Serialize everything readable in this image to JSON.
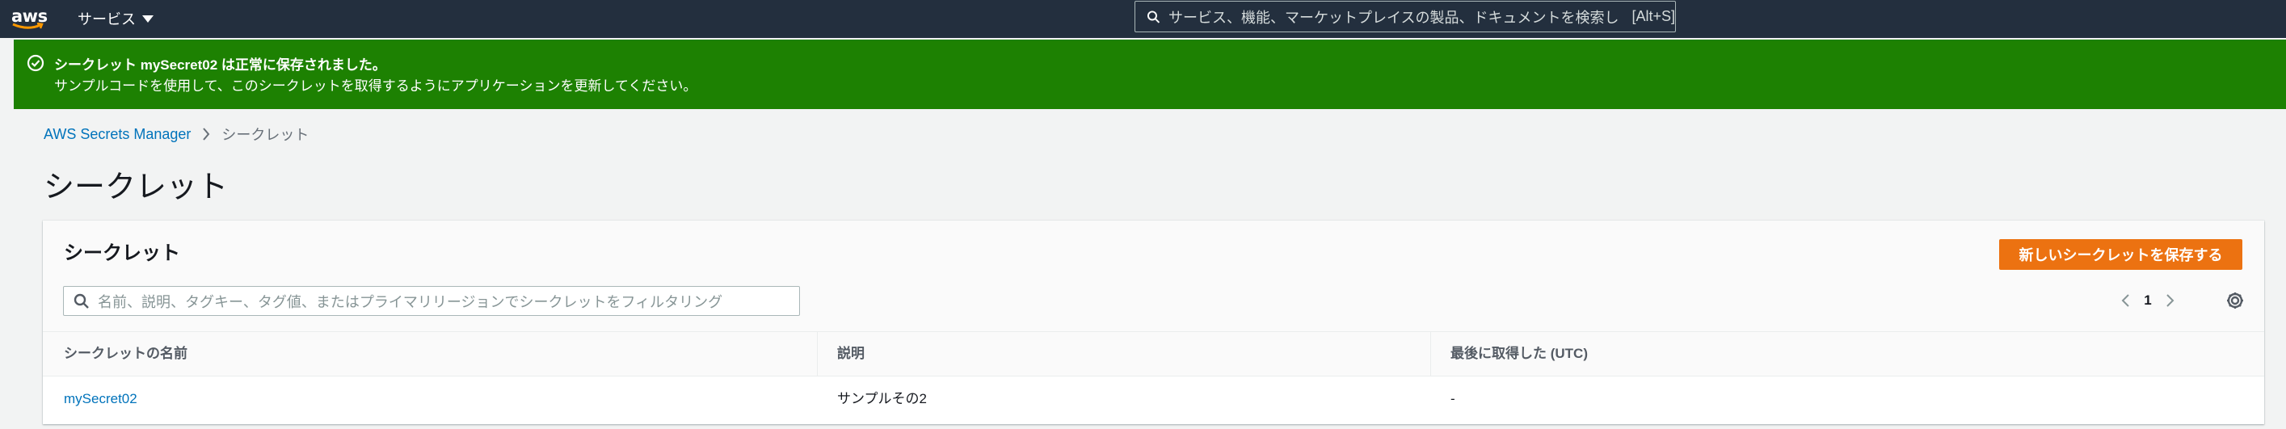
{
  "topnav": {
    "logo_text": "aws",
    "services_label": "サービス",
    "search_placeholder": "サービス、機能、マーケットプレイスの製品、ドキュメントを検索し",
    "search_shortcut": "[Alt+S]"
  },
  "flash": {
    "title": "シークレット mySecret02 は正常に保存されました。",
    "message": "サンプルコードを使用して、このシークレットを取得するようにアプリケーションを更新してください。"
  },
  "breadcrumb": {
    "root": "AWS Secrets Manager",
    "current": "シークレット"
  },
  "page_title": "シークレット",
  "table": {
    "title": "シークレット",
    "create_button": "新しいシークレットを保存する",
    "filter_placeholder": "名前、説明、タグキー、タグ値、またはプライマリリージョンでシークレットをフィルタリング",
    "page_number": "1",
    "columns": [
      "シークレットの名前",
      "説明",
      "最後に取得した (UTC)"
    ],
    "rows": [
      {
        "name": "mySecret02",
        "description": "サンプルその2",
        "last_retrieved": "-"
      }
    ]
  },
  "colors": {
    "nav_bg": "#232f3e",
    "success_bg": "#1d8102",
    "primary_button": "#ec7211",
    "link": "#0073bb"
  },
  "icons": [
    "search-icon",
    "check-circle-icon",
    "chevron-right-icon",
    "chevron-left-icon",
    "gear-icon",
    "caret-down-icon"
  ]
}
